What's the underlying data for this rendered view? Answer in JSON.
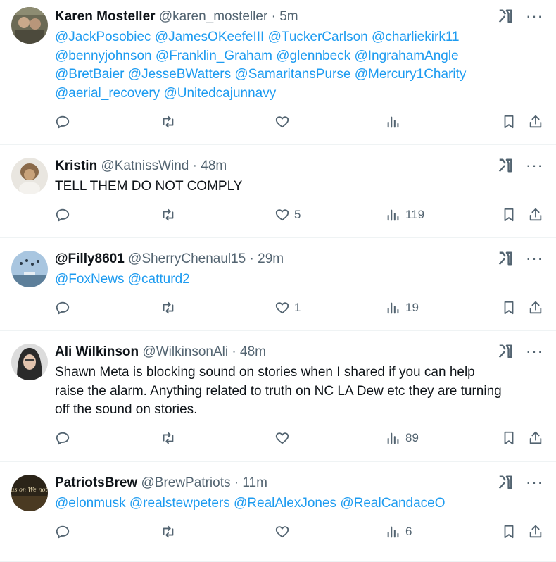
{
  "tweets": [
    {
      "name": "Karen Mosteller",
      "handle": "@karen_mosteller",
      "dot": "·",
      "time": "5m",
      "mentions": [
        "@JackPosobiec",
        "@JamesOKeefeIII",
        "@TuckerCarlson",
        "@charliekirk11",
        "@bennyjohnson",
        "@Franklin_Graham",
        "@glennbeck",
        "@IngrahamAngle",
        "@BretBaier",
        "@JesseBWatters",
        "@SamaritansPurse",
        "@Mercury1Charity",
        "@aerial_recovery",
        "@Unitedcajunnavy"
      ],
      "likes": "",
      "views": ""
    },
    {
      "name": "Kristin",
      "handle": "@KatnissWind",
      "dot": "·",
      "time": "48m",
      "text": "TELL THEM DO NOT COMPLY",
      "likes": "5",
      "views": "119"
    },
    {
      "name": "@Filly8601",
      "handle": "@SherryChenaul15",
      "dot": "·",
      "time": "29m",
      "mentions": [
        "@FoxNews",
        "@catturd2"
      ],
      "likes": "1",
      "views": "19"
    },
    {
      "name": "Ali Wilkinson",
      "handle": "@WilkinsonAli",
      "dot": "·",
      "time": "48m",
      "text_lines": [
        "Shawn Meta is blocking sound on stories when I shared if you can help",
        "raise the alarm.  Anything related to truth on NC LA Dew etc they are turning",
        "off the sound on stories."
      ],
      "likes": "",
      "views": "89"
    },
    {
      "name": "PatriotsBrew",
      "handle": "@BrewPatriots",
      "dot": "·",
      "time": "11m",
      "mentions": [
        "@elonmusk",
        "@realstewpeters",
        "@RealAlexJones",
        "@RealCandaceO"
      ],
      "avatar_text": "Focus on We not Me",
      "likes": "",
      "views": "6"
    }
  ],
  "more_glyph": "···",
  "colors": {
    "mention": "#1d9bf0",
    "secondary": "#536471",
    "primary": "#0f1419",
    "divider": "#eff3f4"
  }
}
